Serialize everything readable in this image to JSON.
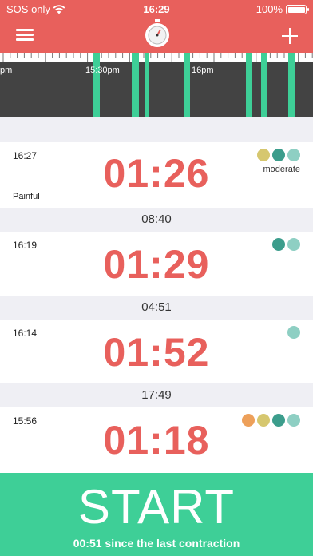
{
  "status_bar": {
    "carrier": "SOS only",
    "time": "16:29",
    "battery": "100%"
  },
  "header": {
    "menu_icon": "hamburger-menu-icon",
    "center_icon": "stopwatch-icon",
    "add_icon": "plus-icon"
  },
  "timeline": {
    "labels": [
      "pm",
      "15:30pm",
      "16pm"
    ]
  },
  "contractions": [
    {
      "time": "16:27",
      "duration": "01:26",
      "intensity_label": "moderate",
      "note": "Painful",
      "dot_colors": [
        "#d6c76f",
        "#3c9d8c",
        "#8ecfc3"
      ]
    },
    {
      "time": "16:19",
      "duration": "01:29",
      "dot_colors": [
        "#3c9d8c",
        "#8ecfc3"
      ]
    },
    {
      "time": "16:14",
      "duration": "01:52",
      "dot_colors": [
        "#8ecfc3"
      ]
    },
    {
      "time": "15:56",
      "duration": "01:18",
      "dot_colors": [
        "#eda05a",
        "#d6c76f",
        "#3c9d8c",
        "#8ecfc3"
      ]
    }
  ],
  "intervals": [
    "08:40",
    "04:51",
    "17:49"
  ],
  "start_button": {
    "label": "START",
    "since_text": "00:51 since the last contraction"
  },
  "colors": {
    "header": "#e8605c",
    "duration_text": "#e8605c",
    "start_bg": "#3ecf97",
    "timeline_bg": "#434343",
    "timeline_bar": "#3ecf97"
  }
}
